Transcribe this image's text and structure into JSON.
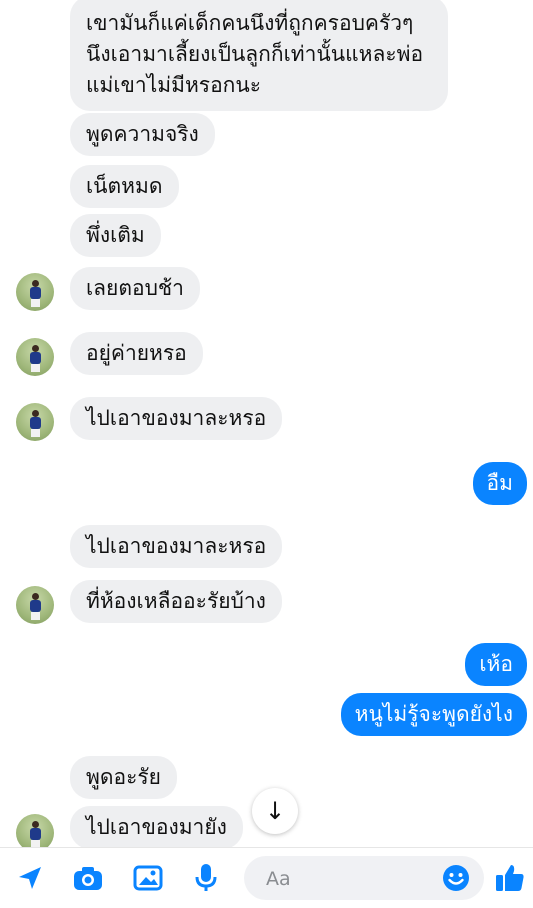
{
  "conversation": {
    "messages": [
      {
        "id": "m1",
        "lines": [
          "เขามันก็แค่เด็กคนนึงที่ถูกครอบครัวๆ",
          "นึงเอามาเลี้ยงเป็นลูกก็เท่านั้นแหละพ่อ",
          "แม่เขาไม่มีหรอกนะ"
        ]
      },
      {
        "id": "m2",
        "text": "พูดความจริง"
      },
      {
        "id": "m3",
        "text": "เน็ตหมด"
      },
      {
        "id": "m4",
        "text": "พึ่งเติม"
      },
      {
        "id": "m5",
        "text": "เลยตอบช้า"
      },
      {
        "id": "m6",
        "text": "อยู่ค่ายหรอ"
      },
      {
        "id": "m7",
        "text": "ไปเอาของมาละหรอ"
      },
      {
        "id": "m8",
        "text": "อืม"
      },
      {
        "id": "m9",
        "text": "ไปเอาของมาละหรอ"
      },
      {
        "id": "m10",
        "text": "ที่ห้องเหลืออะรัยบ้าง"
      },
      {
        "id": "m11",
        "text": "เห้อ"
      },
      {
        "id": "m12",
        "text": "หนูไม่รู้จะพูดยังไง"
      },
      {
        "id": "m13",
        "text": "พูดอะรัย"
      },
      {
        "id": "m14",
        "text": "ไปเอาของมายัง"
      }
    ]
  },
  "scroll_button": {
    "icon": "arrow-down-icon",
    "glyph": "↓"
  },
  "composer": {
    "placeholder": "Aa",
    "icons": [
      "send-location-icon",
      "camera-icon",
      "gallery-icon",
      "microphone-icon",
      "emoji-icon",
      "like-icon"
    ]
  },
  "colors": {
    "incoming_bubble": "#eeeff1",
    "outgoing_bubble": "#0a84ff",
    "accent": "#0a84ff"
  }
}
